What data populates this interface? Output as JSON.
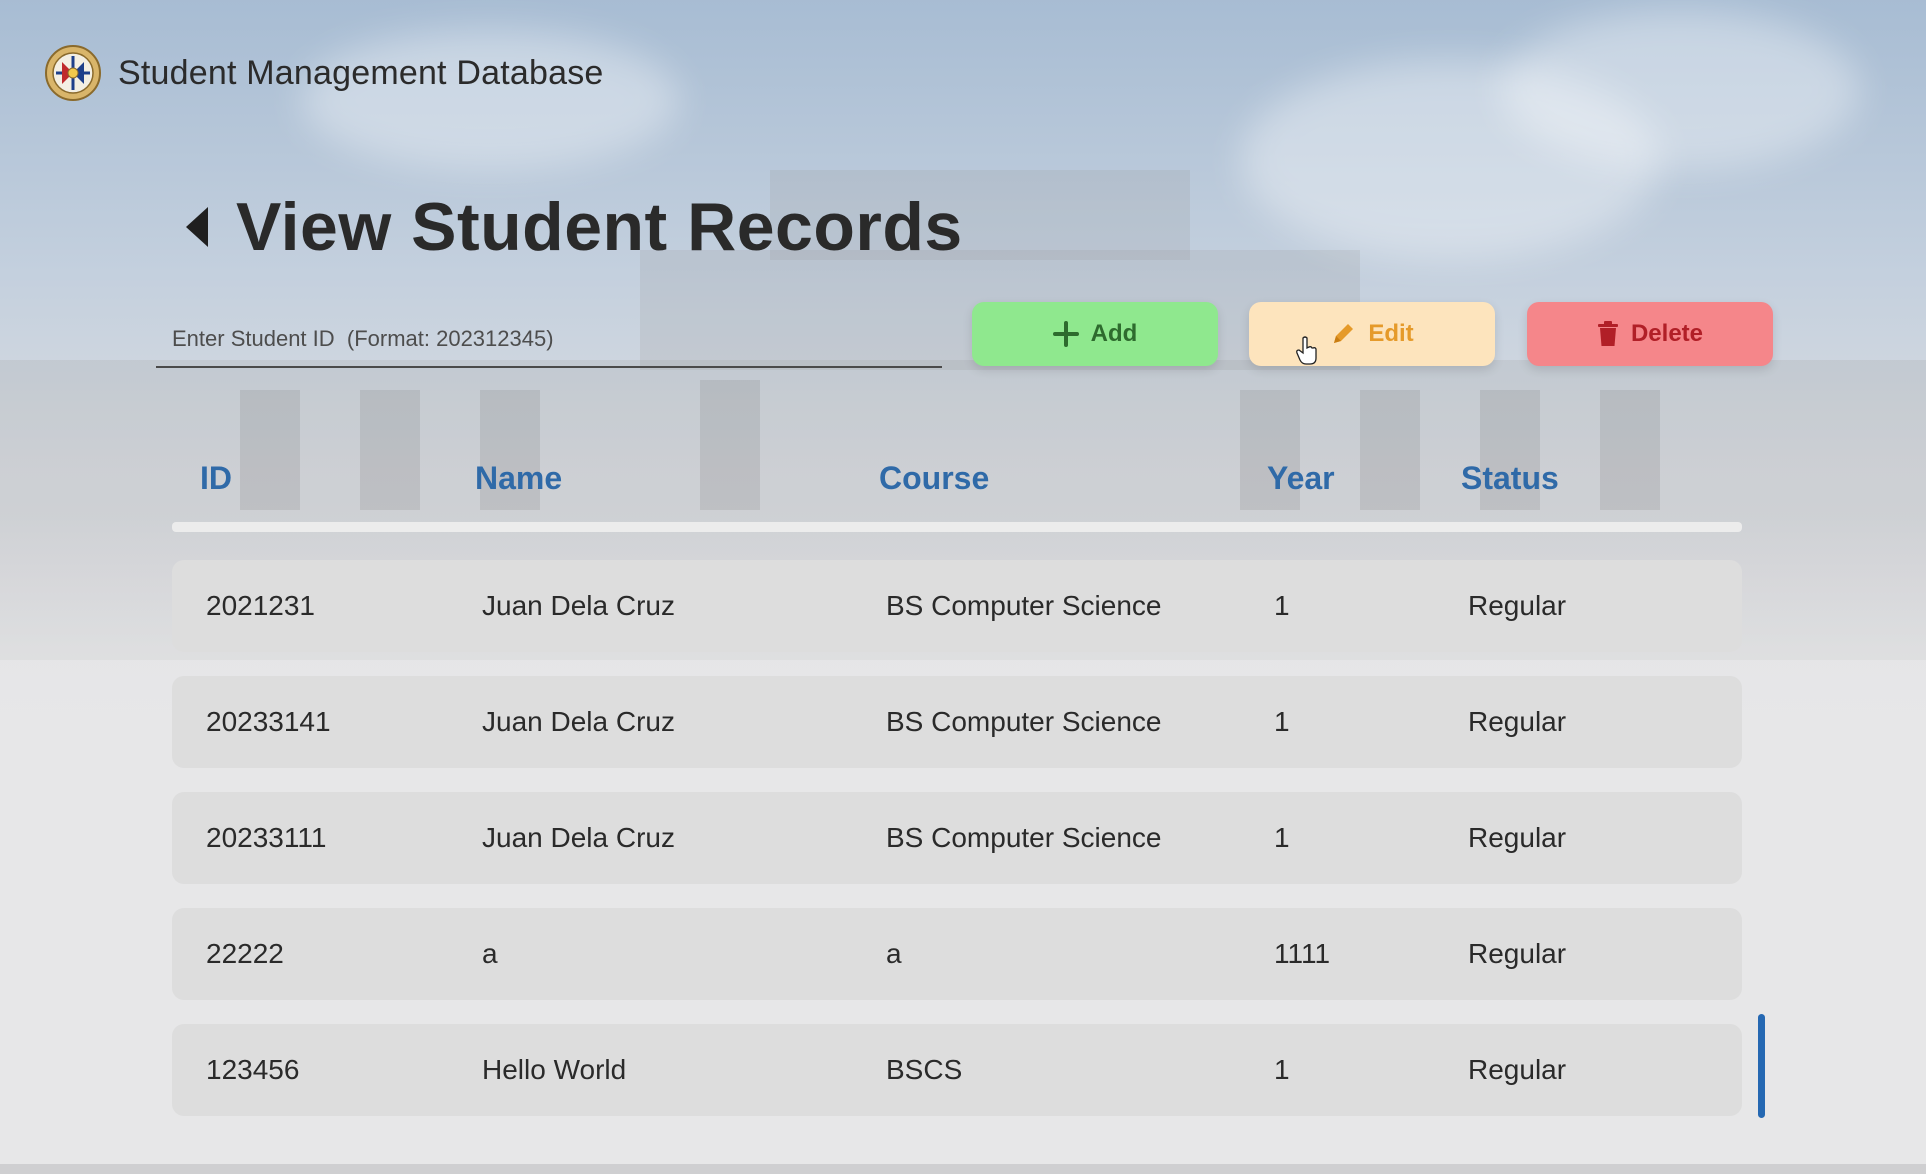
{
  "app": {
    "title": "Student Management Database"
  },
  "page": {
    "title": "View Student Records"
  },
  "search": {
    "placeholder": "Enter Student ID  (Format: 202312345)",
    "value": ""
  },
  "actions": {
    "add_label": "Add",
    "edit_label": "Edit",
    "delete_label": "Delete"
  },
  "table": {
    "columns": [
      "ID",
      "Name",
      "Course",
      "Year",
      "Status"
    ],
    "rows": [
      {
        "id": "2021231",
        "name": "Juan Dela Cruz",
        "course": "BS Computer Science",
        "year": "1",
        "status": "Regular"
      },
      {
        "id": "20233141",
        "name": "Juan Dela Cruz",
        "course": "BS Computer Science",
        "year": "1",
        "status": "Regular"
      },
      {
        "id": "20233111",
        "name": "Juan Dela Cruz",
        "course": "BS Computer Science",
        "year": "1",
        "status": "Regular"
      },
      {
        "id": "22222",
        "name": "a",
        "course": "a",
        "year": "1111",
        "status": "Regular"
      },
      {
        "id": "123456",
        "name": "Hello World",
        "course": "BSCS",
        "year": "1",
        "status": "Regular"
      }
    ]
  },
  "colors": {
    "header_text": "#2f6aa8",
    "add": "#8fe88e",
    "edit": "#fde4bd",
    "delete": "#f5868a",
    "scrollbar": "#2568b2"
  },
  "icons": {
    "logo": "university-seal-icon",
    "back": "back-triangle-icon",
    "add": "plus-icon",
    "edit": "pencil-icon",
    "delete": "trash-icon"
  }
}
